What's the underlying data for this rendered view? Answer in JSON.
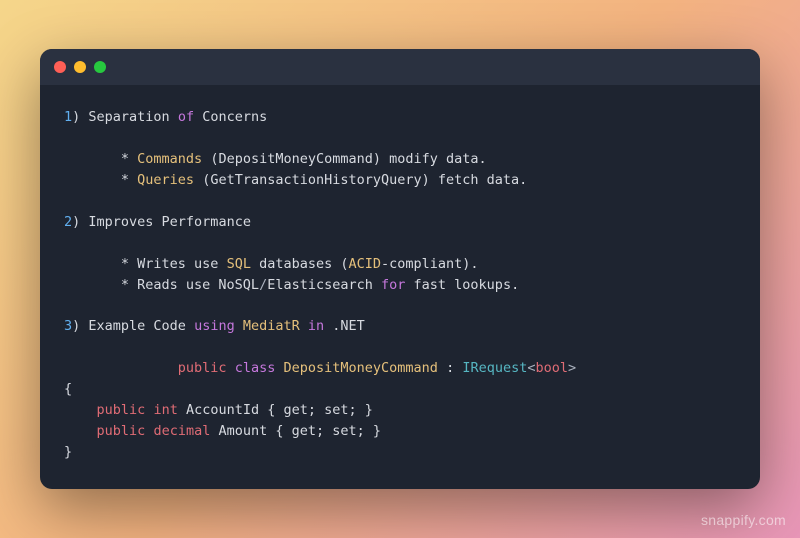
{
  "lines": [
    {
      "segments": [
        {
          "t": "1",
          "c": "num"
        },
        {
          "t": ") Separation ",
          "c": "white"
        },
        {
          "t": "of",
          "c": "kw"
        },
        {
          "t": " Concerns",
          "c": "white"
        }
      ]
    },
    {
      "segments": [
        {
          "t": "",
          "c": "white"
        }
      ]
    },
    {
      "segments": [
        {
          "t": "       * ",
          "c": "white"
        },
        {
          "t": "Commands",
          "c": "type"
        },
        {
          "t": " (DepositMoneyCommand) modify data.",
          "c": "white"
        }
      ]
    },
    {
      "segments": [
        {
          "t": "       * ",
          "c": "white"
        },
        {
          "t": "Queries",
          "c": "type"
        },
        {
          "t": " (GetTransactionHistoryQuery) fetch data.",
          "c": "white"
        }
      ]
    },
    {
      "segments": [
        {
          "t": "",
          "c": "white"
        }
      ]
    },
    {
      "segments": [
        {
          "t": "2",
          "c": "num"
        },
        {
          "t": ") Improves Performance",
          "c": "white"
        }
      ]
    },
    {
      "segments": [
        {
          "t": "",
          "c": "white"
        }
      ]
    },
    {
      "segments": [
        {
          "t": "       * Writes use ",
          "c": "white"
        },
        {
          "t": "SQL",
          "c": "type"
        },
        {
          "t": " databases (",
          "c": "white"
        },
        {
          "t": "ACID",
          "c": "type"
        },
        {
          "t": "-compliant).",
          "c": "white"
        }
      ]
    },
    {
      "segments": [
        {
          "t": "       * Reads use NoSQL",
          "c": "white"
        },
        {
          "t": "/",
          "c": "op"
        },
        {
          "t": "Elasticsearch ",
          "c": "white"
        },
        {
          "t": "for",
          "c": "kw"
        },
        {
          "t": " fast lookups.",
          "c": "white"
        }
      ]
    },
    {
      "segments": [
        {
          "t": "",
          "c": "white"
        }
      ]
    },
    {
      "segments": [
        {
          "t": "3",
          "c": "num"
        },
        {
          "t": ") Example Code ",
          "c": "white"
        },
        {
          "t": "using",
          "c": "kw"
        },
        {
          "t": " ",
          "c": "white"
        },
        {
          "t": "MediatR",
          "c": "type"
        },
        {
          "t": " ",
          "c": "white"
        },
        {
          "t": "in",
          "c": "kw"
        },
        {
          "t": " .NET",
          "c": "white"
        }
      ]
    },
    {
      "segments": [
        {
          "t": "",
          "c": "white"
        }
      ]
    },
    {
      "segments": [
        {
          "t": "              ",
          "c": "white"
        },
        {
          "t": "public",
          "c": "kw2"
        },
        {
          "t": " ",
          "c": "white"
        },
        {
          "t": "class",
          "c": "kw"
        },
        {
          "t": " ",
          "c": "white"
        },
        {
          "t": "DepositMoneyCommand",
          "c": "type"
        },
        {
          "t": " : ",
          "c": "white"
        },
        {
          "t": "IRequest",
          "c": "fn"
        },
        {
          "t": "<",
          "c": "op"
        },
        {
          "t": "bool",
          "c": "kw2"
        },
        {
          "t": ">",
          "c": "op"
        }
      ]
    },
    {
      "segments": [
        {
          "t": "{",
          "c": "white"
        }
      ]
    },
    {
      "segments": [
        {
          "t": "    ",
          "c": "white"
        },
        {
          "t": "public",
          "c": "kw2"
        },
        {
          "t": " ",
          "c": "white"
        },
        {
          "t": "int",
          "c": "kw2"
        },
        {
          "t": " AccountId { ",
          "c": "white"
        },
        {
          "t": "get",
          "c": "white"
        },
        {
          "t": "; ",
          "c": "white"
        },
        {
          "t": "set",
          "c": "white"
        },
        {
          "t": "; }",
          "c": "white"
        }
      ]
    },
    {
      "segments": [
        {
          "t": "    ",
          "c": "white"
        },
        {
          "t": "public",
          "c": "kw2"
        },
        {
          "t": " ",
          "c": "white"
        },
        {
          "t": "decimal",
          "c": "kw2"
        },
        {
          "t": " Amount { ",
          "c": "white"
        },
        {
          "t": "get",
          "c": "white"
        },
        {
          "t": "; ",
          "c": "white"
        },
        {
          "t": "set",
          "c": "white"
        },
        {
          "t": "; }",
          "c": "white"
        }
      ]
    },
    {
      "segments": [
        {
          "t": "}",
          "c": "white"
        }
      ]
    }
  ],
  "watermark": "snappify.com"
}
